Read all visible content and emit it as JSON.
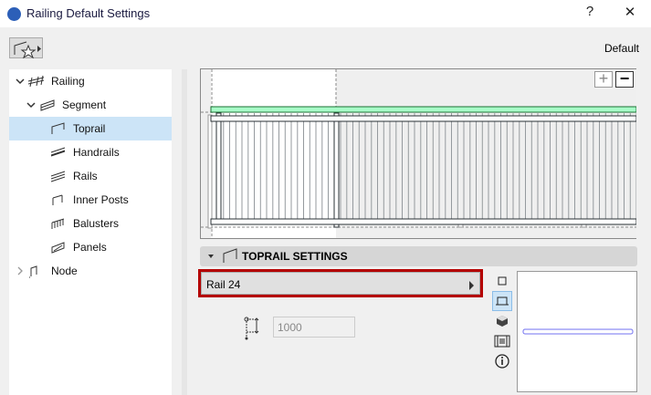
{
  "window": {
    "title": "Railing Default Settings",
    "help": "?",
    "close": "✕"
  },
  "header": {
    "default_label": "Default"
  },
  "tree": [
    {
      "label": "Railing",
      "level": 0,
      "expander": "down"
    },
    {
      "label": "Segment",
      "level": 1,
      "expander": "down"
    },
    {
      "label": "Toprail",
      "level": 2,
      "selected": true
    },
    {
      "label": "Handrails",
      "level": 2
    },
    {
      "label": "Rails",
      "level": 2
    },
    {
      "label": "Inner Posts",
      "level": 2
    },
    {
      "label": "Balusters",
      "level": 2
    },
    {
      "label": "Panels",
      "level": 2
    },
    {
      "label": "Node",
      "level": 0,
      "expander": "right"
    }
  ],
  "preview": {
    "zoom_in": "+",
    "zoom_out": "−",
    "highlight_color": "#a8ffc8"
  },
  "section": {
    "title": "TOPRAIL SETTINGS"
  },
  "profile": {
    "name": "Rail 24"
  },
  "height": {
    "value": "1000"
  },
  "accent": "#b40000"
}
